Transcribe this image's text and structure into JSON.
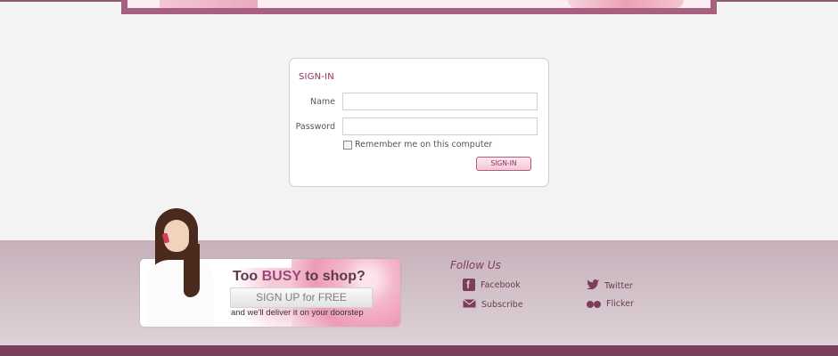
{
  "colors": {
    "accent": "#8e2f5f",
    "footer_band": "#7a3f5a",
    "hero_frame": "#a8607f"
  },
  "signin": {
    "title": "SIGN-IN",
    "name_label": "Name",
    "name_value": "",
    "password_label": "Password",
    "password_value": "",
    "remember_label": "Remember me on this computer",
    "remember_checked": false,
    "button_label": "SIGN-IN"
  },
  "promo": {
    "headline_pre": "Too ",
    "headline_busy": "BUSY",
    "headline_post": " to shop?",
    "button_label": "SIGN UP for FREE",
    "subtext": "and we'll deliver it on your doorstep"
  },
  "follow": {
    "title": "Follow Us",
    "links": [
      {
        "label": "Facebook",
        "icon": "facebook-icon"
      },
      {
        "label": "Subscribe",
        "icon": "mail-icon"
      },
      {
        "label": "Twitter",
        "icon": "twitter-bird-icon"
      },
      {
        "label": "Flicker",
        "icon": "flickr-icon"
      }
    ]
  }
}
